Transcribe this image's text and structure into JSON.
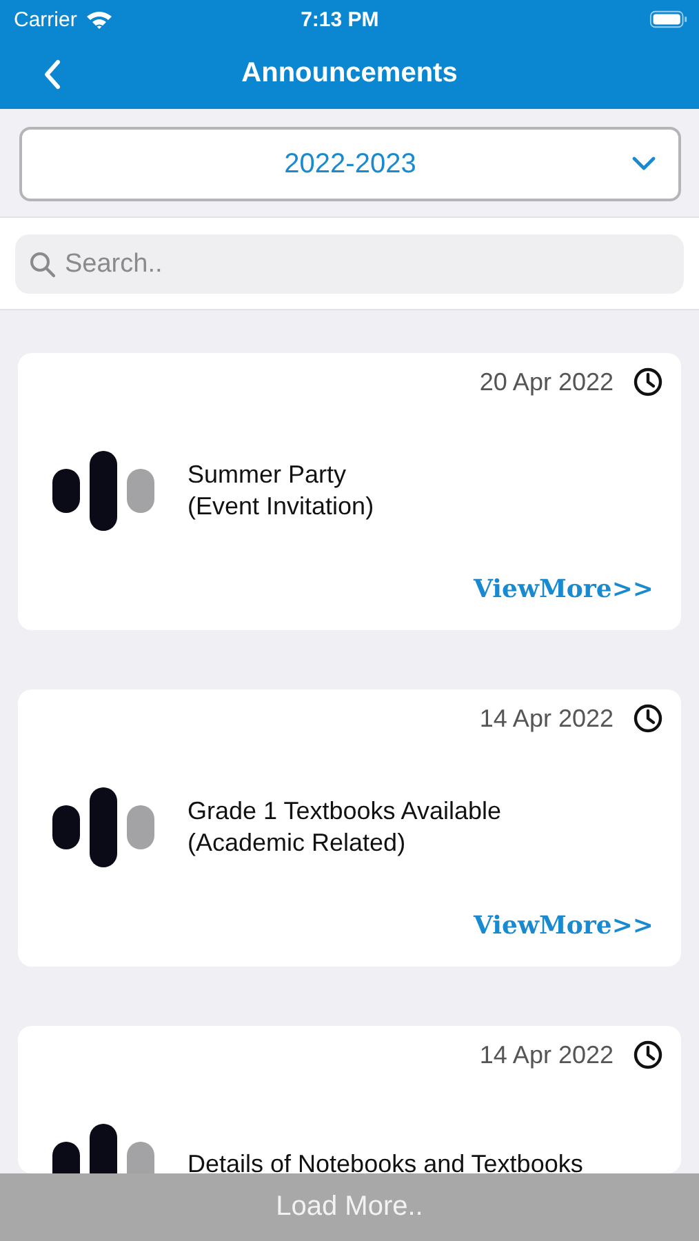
{
  "status_bar": {
    "carrier": "Carrier",
    "time": "7:13 PM"
  },
  "nav": {
    "title": "Announcements"
  },
  "year_picker": {
    "value": "2022-2023"
  },
  "search": {
    "placeholder": "Search.."
  },
  "announcements": [
    {
      "date": "20 Apr 2022",
      "title": [
        "Summer Party",
        "(Event Invitation)"
      ],
      "link": "ViewMore>>"
    },
    {
      "date": "14 Apr 2022",
      "title": [
        "Grade 1 Textbooks Available",
        "(Academic Related)"
      ],
      "link": "ViewMore>>"
    },
    {
      "date": "14 Apr 2022",
      "title": [
        "Details of Notebooks and Textbooks"
      ]
    }
  ],
  "load_more": "Load More.."
}
